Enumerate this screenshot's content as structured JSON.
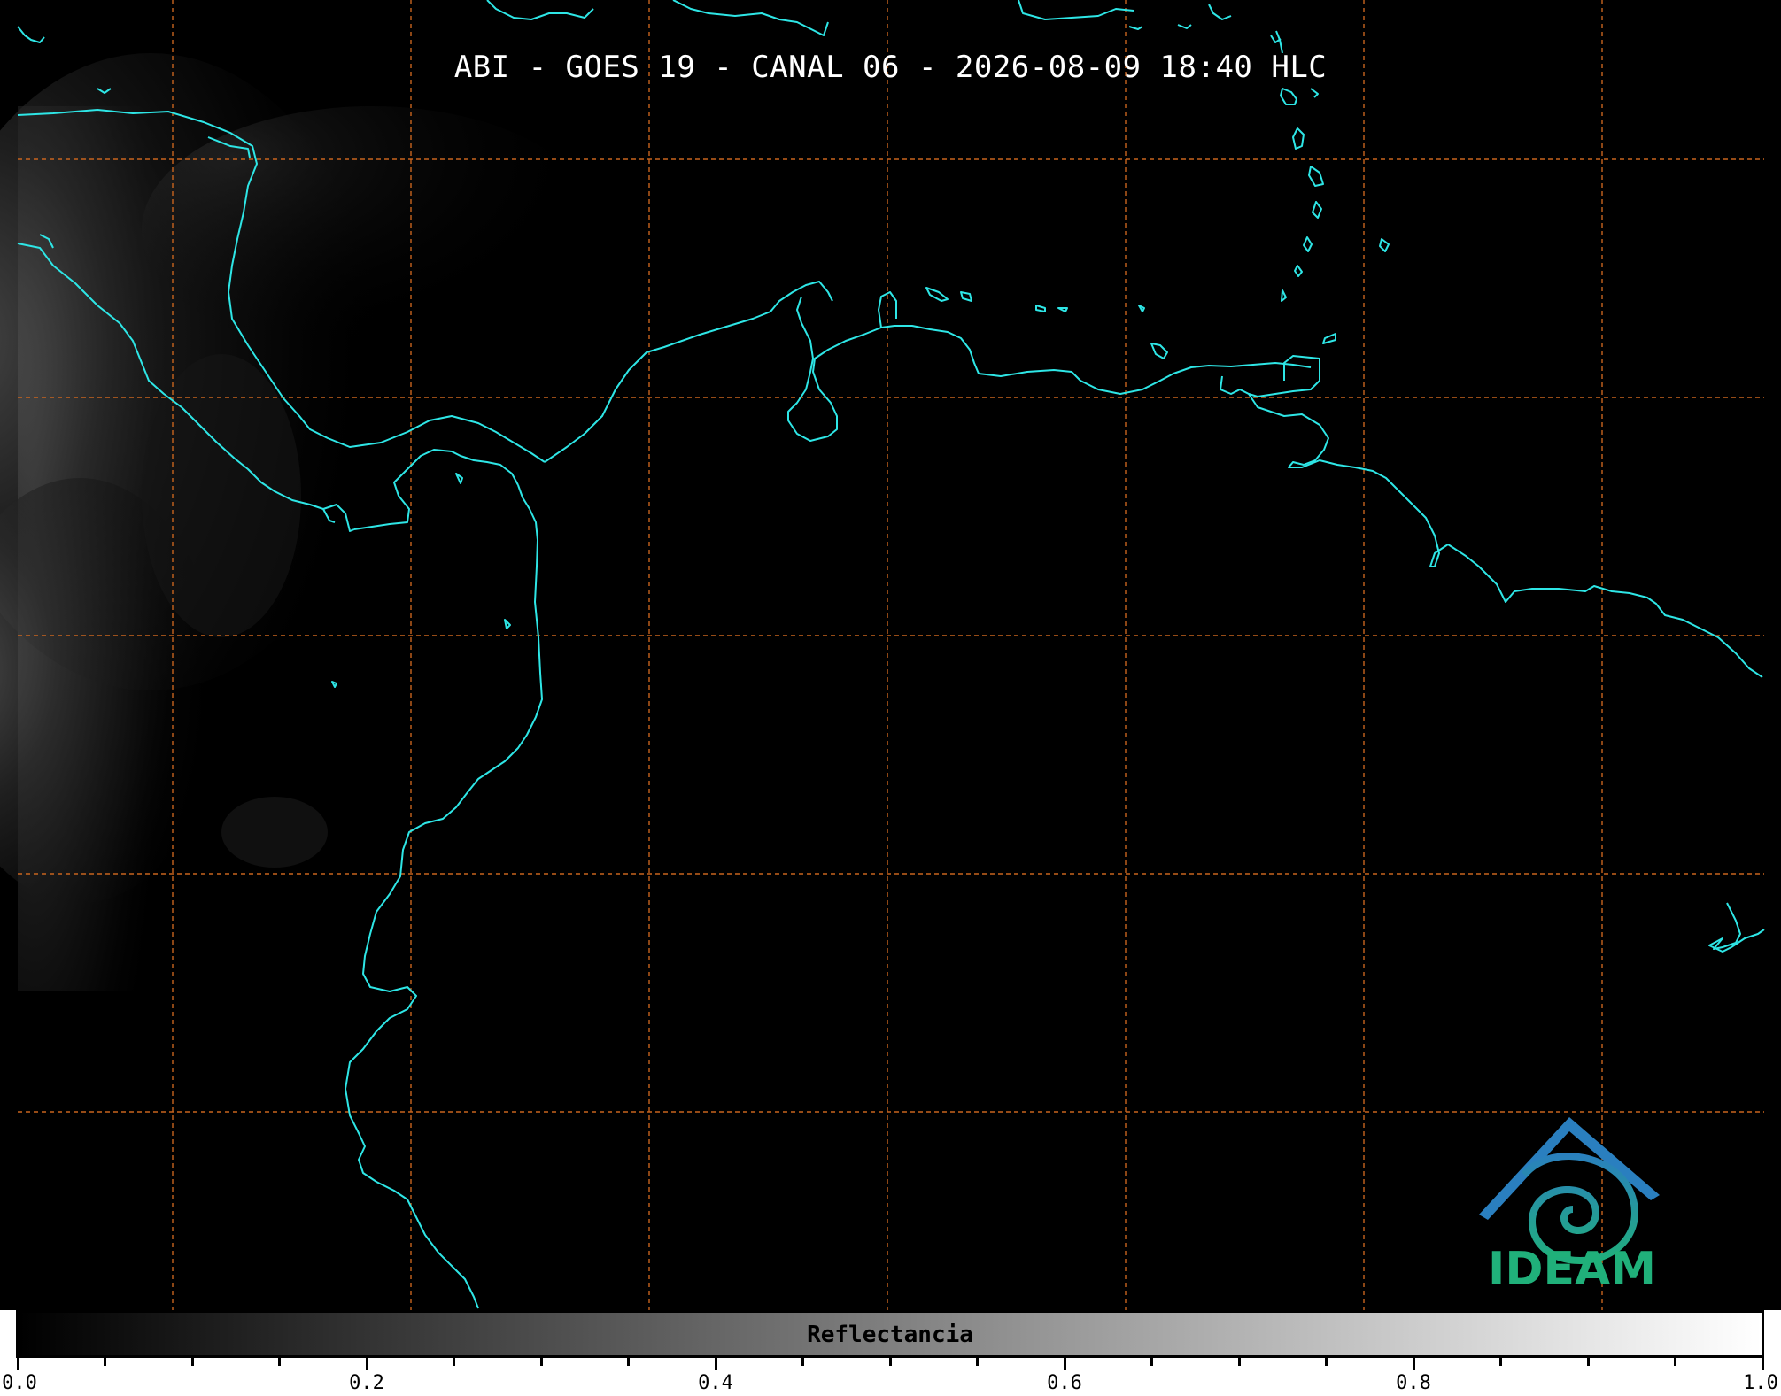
{
  "map": {
    "title": "ABI - GOES 19 - CANAL 06 - 2026-08-09 18:40 HLC",
    "background_color": "#000000",
    "coastline_color": "#2ee6e6",
    "gridline_color": "#c8641e",
    "gridline_style": "dashed"
  },
  "logo": {
    "text": "IDEAM",
    "icon": "ideam-mountain-spiral-icon",
    "color_top": "#2a7fbf",
    "color_bottom": "#20b07a"
  },
  "colorbar": {
    "label": "Reflectancia",
    "min": 0.0,
    "max": 1.0,
    "color_start": "#000000",
    "color_end": "#ffffff",
    "tick_labels": [
      "0.0",
      "0.2",
      "0.4",
      "0.6",
      "0.8",
      "1.0"
    ],
    "minor_ticks_per_major": 4
  }
}
